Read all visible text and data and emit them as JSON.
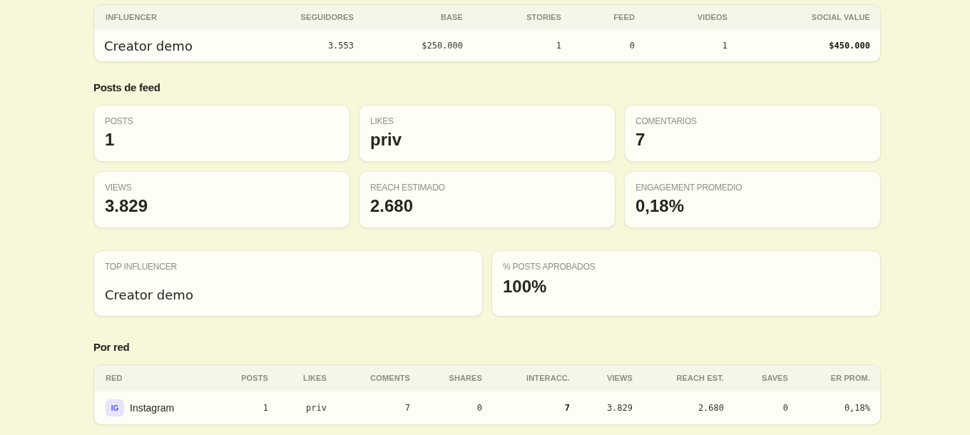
{
  "influencer_table": {
    "columns": [
      {
        "label": "INFLUENCER",
        "highlight": false
      },
      {
        "label": "SEGUIDORES",
        "highlight": false
      },
      {
        "label": "BASE",
        "highlight": false
      },
      {
        "label": "STORIES",
        "highlight": false
      },
      {
        "label": "FEED",
        "highlight": false
      },
      {
        "label": "VIDEOS",
        "highlight": false
      },
      {
        "label": "SOCIAL VALUE",
        "highlight": true
      }
    ],
    "rows": [
      {
        "influencer": "Creator demo",
        "values": [
          "3.553",
          "$250.000",
          "1",
          "0",
          "1",
          "$450.000"
        ]
      }
    ]
  },
  "feed_section": {
    "title": "Posts de feed",
    "stats": [
      {
        "label": "POSTS",
        "value": "1"
      },
      {
        "label": "LIKES",
        "value": "priv"
      },
      {
        "label": "COMENTARIOS",
        "value": "7"
      },
      {
        "label": "VIEWS",
        "value": "3.829"
      },
      {
        "label": "REACH ESTIMADO",
        "value": "2.680"
      },
      {
        "label": "ENGAGEMENT PROMEDIO",
        "value": "0,18%"
      }
    ]
  },
  "highlights": [
    {
      "kind": "name",
      "label": "TOP INFLUENCER",
      "value": "Creator demo"
    },
    {
      "kind": "metric",
      "label": "% POSTS APROBADOS",
      "value": "100%"
    }
  ],
  "network_section": {
    "title": "Por red",
    "columns": [
      {
        "label": "RED",
        "highlight": false
      },
      {
        "label": "POSTS",
        "highlight": false
      },
      {
        "label": "LIKES",
        "highlight": false
      },
      {
        "label": "COMENTS",
        "highlight": false
      },
      {
        "label": "SHARES",
        "highlight": false
      },
      {
        "label": "INTERACC.",
        "highlight": true
      },
      {
        "label": "VIEWS",
        "highlight": false
      },
      {
        "label": "REACH EST.",
        "highlight": false
      },
      {
        "label": "SAVES",
        "highlight": false
      },
      {
        "label": "ER PROM.",
        "highlight": false
      }
    ],
    "rows": [
      {
        "badge": "IG",
        "network": "Instagram",
        "values": [
          "1",
          "priv",
          "7",
          "0",
          "7",
          "3.829",
          "2.680",
          "0",
          "0,18%"
        ]
      }
    ]
  }
}
